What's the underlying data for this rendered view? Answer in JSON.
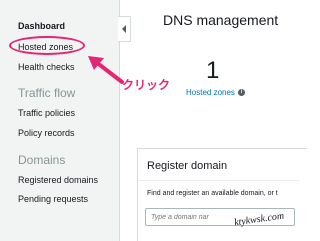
{
  "sidebar": {
    "items": [
      {
        "label": "Dashboard"
      },
      {
        "label": "Hosted zones"
      },
      {
        "label": "Health checks"
      }
    ],
    "traffic_flow": {
      "heading": "Traffic flow",
      "items": [
        {
          "label": "Traffic policies"
        },
        {
          "label": "Policy records"
        }
      ]
    },
    "domains": {
      "heading": "Domains",
      "items": [
        {
          "label": "Registered domains"
        },
        {
          "label": "Pending requests"
        }
      ]
    }
  },
  "annotation": {
    "text": "クリック",
    "color": "#e62575"
  },
  "main": {
    "title": "DNS management",
    "hosted_count": "1",
    "hosted_link": "Hosted zones"
  },
  "register": {
    "title": "Register domain",
    "description": "Find and register an available domain, or t",
    "placeholder": "Type a domain nar"
  },
  "watermark": "ktykwsk.com",
  "colors": {
    "link": "#0073bb",
    "annotation": "#e62575",
    "sidebar_bg": "#f2f3f3"
  }
}
